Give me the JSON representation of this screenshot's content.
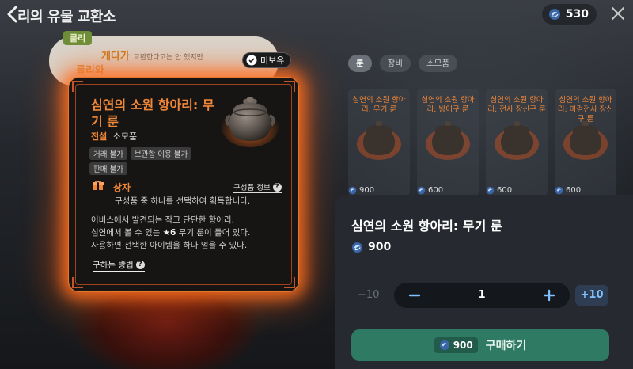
{
  "header": {
    "title": "리의 유물 교환소",
    "currency_amount": "530"
  },
  "bubble": {
    "tag": "룰리",
    "line1_a": "게다가",
    "line1_b": "교환한다고는 안 했지만",
    "line2": "룰리와 "
  },
  "status_badge": "미보유",
  "card": {
    "title": "심연의 소원 항아리: 무기 룬",
    "rarity": "전설",
    "type": "소모품",
    "tags": [
      "거래 불가",
      "보관함 이용 불가",
      "판매 불가"
    ],
    "box_label": "상자",
    "info_link": "구성품 정보",
    "box_desc": "구성품 중 하나를 선택하여 획득합니다.",
    "desc_line1": "어비스에서 발견되는 작고 단단한 항아리.",
    "desc_line2_a": "심연에서 볼 수 있는 ",
    "desc_star": "★6",
    "desc_line2_b": " 무기 룬이 들어 있다.",
    "desc_line3": "사용하면 선택한 아이템을 하나 얻을 수 있다.",
    "howto_link": "구하는 방법"
  },
  "tabs": [
    {
      "label": "룬",
      "active": true
    },
    {
      "label": "장비",
      "active": false
    },
    {
      "label": "소모품",
      "active": false
    }
  ],
  "grid": [
    {
      "name": "심연의 소원 항아리: 무기 룬",
      "price": "900"
    },
    {
      "name": "심연의 소원 항아리: 방어구 룬",
      "price": "600"
    },
    {
      "name": "심연의 소원 항아리: 전사 장신구 룬",
      "price": "600"
    },
    {
      "name": "심연의 소원 항아리: 마검전사 장신구 룬",
      "price": "600"
    }
  ],
  "panel": {
    "title": "심연의 소원 항아리: 무기 룬",
    "price": "900",
    "minus10": "−10",
    "quantity": "1",
    "plus10": "+10",
    "buy_price": "900",
    "buy_label": "구매하기"
  },
  "colors": {
    "accent_orange": "#f08638",
    "buy_green": "#2f7a63",
    "plus_blue": "#7fc0ff"
  }
}
